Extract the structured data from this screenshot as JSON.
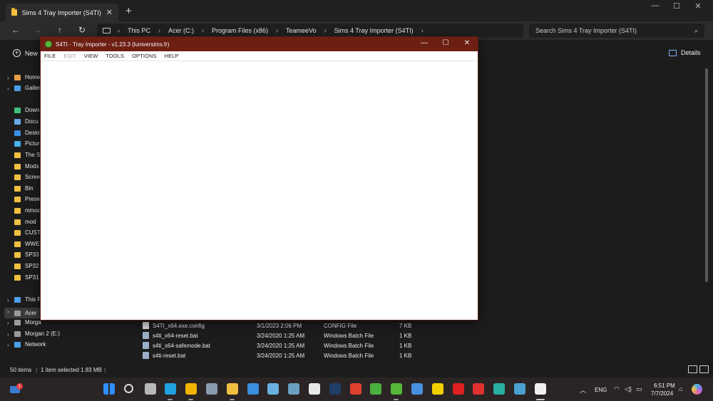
{
  "explorer": {
    "tab_title": "Sims 4 Tray Importer (S4TI)",
    "breadcrumb": [
      "This PC",
      "Acer (C:)",
      "Program Files (x86)",
      "TeameeVo",
      "Sims 4 Tray Importer (S4TI)"
    ],
    "search_placeholder": "Search Sims 4 Tray Importer (S4TI)",
    "new_label": "New",
    "details_label": "Details",
    "sidebar": [
      {
        "label": "Home",
        "icon": "home-icon",
        "color": "#e8a04a"
      },
      {
        "label": "Galler",
        "icon": "gallery-icon",
        "color": "#4a9fe8"
      },
      {
        "label": "Down",
        "icon": "download-icon",
        "color": "#3fbf7f"
      },
      {
        "label": "Docu",
        "icon": "document-icon",
        "color": "#6aa6e8"
      },
      {
        "label": "Deskto",
        "icon": "desktop-icon",
        "color": "#3a8fe0"
      },
      {
        "label": "Picture",
        "icon": "pictures-icon",
        "color": "#4ab0e8"
      },
      {
        "label": "The Si",
        "icon": "folder-icon",
        "color": "#f0c040"
      },
      {
        "label": "Mods",
        "icon": "folder-icon",
        "color": "#f0c040"
      },
      {
        "label": "Screen",
        "icon": "folder-icon",
        "color": "#f0c040"
      },
      {
        "label": "Bin",
        "icon": "folder-icon",
        "color": "#f0c040"
      },
      {
        "label": "Preset",
        "icon": "folder-icon",
        "color": "#f0c040"
      },
      {
        "label": "mmod",
        "icon": "folder-icon",
        "color": "#f0c040"
      },
      {
        "label": "mod",
        "icon": "folder-icon",
        "color": "#f0c040"
      },
      {
        "label": "CUSTO",
        "icon": "folder-icon",
        "color": "#f0c040"
      },
      {
        "label": "WWE",
        "icon": "folder-icon",
        "color": "#f0c040"
      },
      {
        "label": "SP33",
        "icon": "folder-icon",
        "color": "#f0c040"
      },
      {
        "label": "SP32",
        "icon": "folder-icon",
        "color": "#f0c040"
      },
      {
        "label": "SP31",
        "icon": "folder-icon",
        "color": "#f0c040"
      },
      {
        "label": "This P",
        "icon": "this-pc-icon",
        "color": "#4a9fe8"
      },
      {
        "label": "Acer",
        "icon": "drive-icon",
        "color": "#9a9a9a",
        "selected": true
      },
      {
        "label": "Morga",
        "icon": "drive-icon",
        "color": "#9a9a9a"
      },
      {
        "label": "Morgan 2 (E:)",
        "icon": "drive-icon",
        "color": "#9a9a9a"
      },
      {
        "label": "Network",
        "icon": "network-icon",
        "color": "#4a9fe8"
      }
    ],
    "files": [
      {
        "name": "S4TI_x64.exe.config",
        "date": "3/1/2023 2:06 PM",
        "type": "CONFIG File",
        "size": "7 KB",
        "kind": "config"
      },
      {
        "name": "s4ti_x64-reset.bat",
        "date": "3/24/2020 1:25 AM",
        "type": "Windows Batch File",
        "size": "1 KB",
        "kind": "bat"
      },
      {
        "name": "s4ti_x64-safemode.bat",
        "date": "3/24/2020 1:25 AM",
        "type": "Windows Batch File",
        "size": "1 KB",
        "kind": "bat"
      },
      {
        "name": "s4ti-reset.bat",
        "date": "3/24/2020 1:25 AM",
        "type": "Windows Batch File",
        "size": "1 KB",
        "kind": "bat"
      }
    ],
    "status": {
      "items": "50 items",
      "selected": "1 item selected  1.83 MB"
    }
  },
  "s4ti": {
    "title": "S4TI - Tray Importer - v1.23.3  (luniversims.fr)",
    "menu": [
      {
        "label": "FILE",
        "enabled": true
      },
      {
        "label": "EDIT",
        "enabled": false
      },
      {
        "label": "VIEW",
        "enabled": true
      },
      {
        "label": "TOOLS",
        "enabled": true
      },
      {
        "label": "OPTIONS",
        "enabled": true
      },
      {
        "label": "HELP",
        "enabled": true
      }
    ]
  },
  "taskbar": {
    "weather_badge": "1",
    "language": "ENG",
    "time": "6:51 PM",
    "date": "7/7/2024",
    "apps": [
      {
        "name": "start-icon",
        "color": "#2f8fff"
      },
      {
        "name": "search-icon",
        "color": "#d8d8d8"
      },
      {
        "name": "task-view-icon",
        "color": "#b8b8b8"
      },
      {
        "name": "edge-icon",
        "color": "#1fa0e0"
      },
      {
        "name": "chrome-icon",
        "color": "#f2b400"
      },
      {
        "name": "settings-icon",
        "color": "#8a9bb0"
      },
      {
        "name": "file-explorer-icon",
        "color": "#f0c040"
      },
      {
        "name": "mail-icon",
        "color": "#3a8fe0"
      },
      {
        "name": "photos-icon",
        "color": "#6ab0e0"
      },
      {
        "name": "calculator-icon",
        "color": "#6aa0c0"
      },
      {
        "name": "store-icon",
        "color": "#e8e8e8"
      },
      {
        "name": "steam-icon",
        "color": "#1f3f66"
      },
      {
        "name": "ea-app-icon",
        "color": "#e04030"
      },
      {
        "name": "sims-icon",
        "color": "#4ab040"
      },
      {
        "name": "s4ti-icon",
        "color": "#55b83a"
      },
      {
        "name": "visual-studio-icon",
        "color": "#4a90e0"
      },
      {
        "name": "sticky-notes-icon",
        "color": "#f2d000"
      },
      {
        "name": "youtube-icon",
        "color": "#e02020"
      },
      {
        "name": "youtube-music-icon",
        "color": "#e03030"
      },
      {
        "name": "clipchamp-icon",
        "color": "#2ab0a0"
      },
      {
        "name": "remote-desktop-icon",
        "color": "#4aa0d0"
      },
      {
        "name": "notepad-icon",
        "color": "#f0f0f0"
      }
    ]
  }
}
